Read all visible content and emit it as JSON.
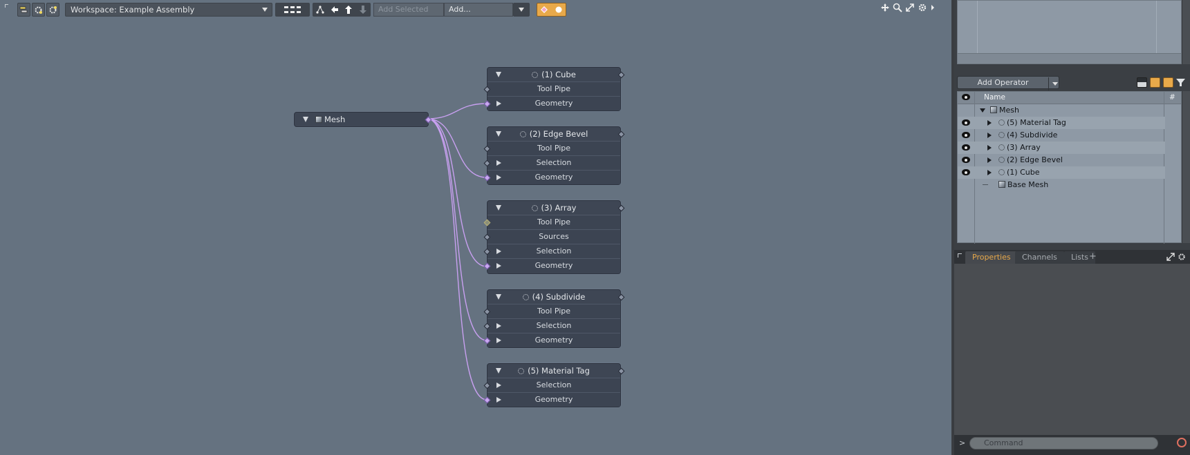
{
  "toolbar": {
    "workspace_select": "Workspace: Example Assembly",
    "add_selected_placeholder": "Add Selected",
    "add_dropdown": "Add..."
  },
  "schematic": {
    "source_node": {
      "title": "Mesh"
    },
    "operator_nodes": [
      {
        "title": "(1) Cube",
        "inputs": [
          "Tool Pipe",
          "Geometry"
        ]
      },
      {
        "title": "(2) Edge Bevel",
        "inputs": [
          "Tool Pipe",
          "Selection",
          "Geometry"
        ]
      },
      {
        "title": "(3) Array",
        "inputs": [
          "Tool Pipe",
          "Sources",
          "Selection",
          "Geometry"
        ]
      },
      {
        "title": "(4) Subdivide",
        "inputs": [
          "Tool Pipe",
          "Selection",
          "Geometry"
        ]
      },
      {
        "title": "(5) Material Tag",
        "inputs": [
          "Selection",
          "Geometry"
        ]
      }
    ],
    "wire_color": "#c8a0f0"
  },
  "mesh_ops": {
    "add_operator_label": "Add Operator",
    "columns": {
      "name": "Name",
      "count": "#"
    },
    "items": [
      {
        "label": "Mesh",
        "icon": "mesh-cube-icon"
      },
      {
        "label": "(5) Material Tag",
        "icon": "gear-icon"
      },
      {
        "label": "(4) Subdivide",
        "icon": "gear-icon"
      },
      {
        "label": "(3) Array",
        "icon": "gear-icon"
      },
      {
        "label": "(2) Edge Bevel",
        "icon": "gear-icon"
      },
      {
        "label": "(1) Cube",
        "icon": "gear-icon"
      },
      {
        "label": "Base Mesh",
        "icon": "mesh-cube-icon"
      }
    ]
  },
  "tabs": {
    "properties": "Properties",
    "channels": "Channels",
    "lists": "Lists",
    "add": "+"
  },
  "command": {
    "prompt": ">",
    "placeholder": "Command"
  },
  "colors": {
    "viewport_bg": "#657280",
    "node_bg": "#3e4654",
    "accent_orange": "#e8a94a"
  }
}
